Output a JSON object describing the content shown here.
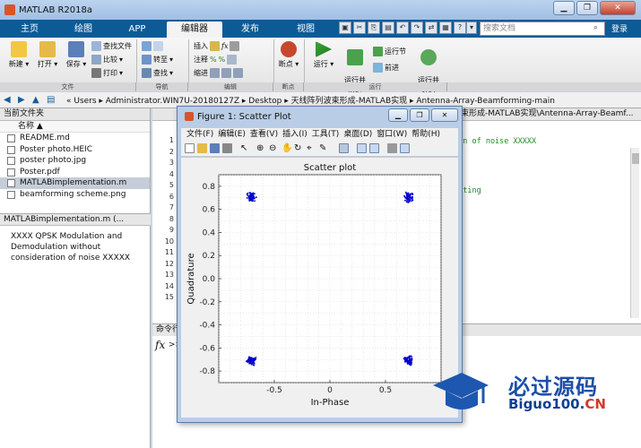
{
  "window": {
    "title": "MATLAB R2018a",
    "min": "▁",
    "max": "❐",
    "close": "✕"
  },
  "ribbon_tabs": [
    "主页",
    "绘图",
    "APP",
    "编辑器",
    "发布",
    "视图"
  ],
  "active_tab": 3,
  "search": {
    "placeholder": "搜索文档"
  },
  "login": "登录",
  "ribbon": {
    "new": "新建",
    "open": "打开",
    "save": "保存",
    "find_files": "查找文件",
    "compare": "比较",
    "print": "打印",
    "goto": "转至",
    "find": "查找",
    "insert": "插入",
    "comment": "注释",
    "indent": "缩进",
    "breakpoints": "断点",
    "run": "运行",
    "run_advance": "运行并\n前进",
    "run_section": "运行节",
    "advance": "前进",
    "run_time": "运行并\n计时",
    "groups": [
      "文件",
      "导航",
      "编辑",
      "断点",
      "运行"
    ]
  },
  "address": {
    "crumbs": "« Users  ▸  Administrator.WIN7U-20180127Z  ▸  Desktop  ▸  天线阵列波束形成-MATLAB实现  ▸  Antenna-Array-Beamforming-main"
  },
  "files_panel": {
    "title": "当前文件夹",
    "column": "名称 ▲",
    "files": [
      "README.md",
      "Poster photo.HEIC",
      "poster photo.jpg",
      "Poster.pdf",
      "MATLABimplementation.m",
      "beamforming scheme.png"
    ],
    "selected": 4
  },
  "details": {
    "title": "MATLABimplementation.m (...",
    "text": "XXXX QPSK Modulation and Demodulation without consideration of noise XXXXX"
  },
  "editor": {
    "header": "编辑器 - C:\\Users\\Administrator.WIN7U-20180127Z\\Desktop\\天线阵列波束形成-MATLAB实现\\Antenna-Array-Beamf...",
    "line_numbers": [
      "1",
      "2",
      "3",
      "4",
      "5",
      "6",
      "7",
      "8",
      "9",
      "10",
      "11",
      "12",
      "13",
      "14",
      "15"
    ],
    "code_line1": "ion of noise XXXXX",
    "code_line5": "otting"
  },
  "command_window": {
    "title": "命令行窗口",
    "prompt": ">>"
  },
  "figure": {
    "title": "Figure 1: Scatter Plot",
    "menu": [
      "文件(F)",
      "编辑(E)",
      "查看(V)",
      "插入(I)",
      "工具(T)",
      "桌面(D)",
      "窗口(W)",
      "帮助(H)"
    ]
  },
  "chart_data": {
    "type": "scatter",
    "title": "Scatter plot",
    "xlabel": "In-Phase",
    "ylabel": "Quadrature",
    "xlim": [
      -1,
      1
    ],
    "ylim": [
      -0.9,
      0.9
    ],
    "xticks": [
      -0.5,
      0,
      0.5
    ],
    "yticks": [
      -0.8,
      -0.6,
      -0.4,
      -0.2,
      0,
      0.2,
      0.4,
      0.6,
      0.8
    ],
    "grid": true,
    "color": "#0000cc",
    "clusters": [
      {
        "x": -0.707,
        "y": 0.707,
        "spread": 0.05
      },
      {
        "x": 0.707,
        "y": 0.707,
        "spread": 0.05
      },
      {
        "x": -0.707,
        "y": -0.707,
        "spread": 0.05
      },
      {
        "x": 0.707,
        "y": -0.707,
        "spread": 0.05
      }
    ],
    "points_per_cluster": 90
  },
  "watermark": {
    "text": "必过源码",
    "url_main": "Biguo100.",
    "url_cn": "CN"
  }
}
